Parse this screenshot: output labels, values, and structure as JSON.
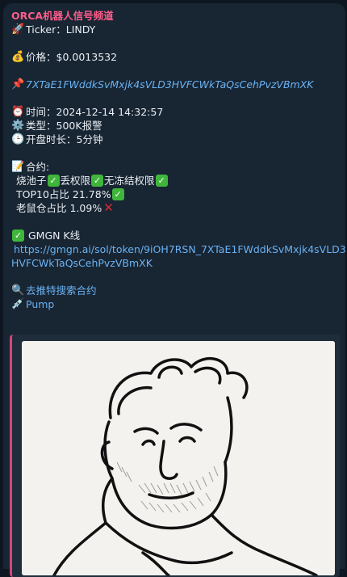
{
  "message": {
    "sender": "ORCA机器人信号频道",
    "ticker_label": "Ticker：",
    "ticker": "LINDY",
    "price_label": "价格：",
    "price": "$0.0013532",
    "contract_address": "7XTaE1FWddkSvMxjk4sVLD3HVFCWkTaQsCehPvzVBmXK",
    "time_label": "时间：",
    "time": "2024-12-14 14:32:57",
    "type_label": "类型：",
    "type": "500K报警",
    "duration_label": "开盘时长：",
    "duration": "5分钟",
    "contract_heading": "合约:",
    "contract_checks": [
      "烧池子",
      "丢权限",
      "无冻结权限"
    ],
    "top10_label": "TOP10占比",
    "top10": "21.78%",
    "rat_label": "老鼠仓占比",
    "rat": "1.09%",
    "gmgn_label": "GMGN K线",
    "gmgn_url_line1": "https://gmgn.ai/sol/token/9iOH7RSN_7XTaE1FWddkSvMxjk4sVLD3",
    "gmgn_url_line2": "HVFCWkTaQsCehPvzVBmXK",
    "search_link": "去推特搜索合约",
    "pump_link": "Pump"
  },
  "icons": {
    "rocket": "rocket-icon",
    "money_bag": "money-bag-icon",
    "pin": "pushpin-icon",
    "clock": "alarm-clock-icon",
    "gear": "gear-icon",
    "timer": "clock-icon",
    "memo": "memo-icon",
    "check": "check-mark-icon",
    "cross": "cross-mark-icon",
    "magnifier": "magnifier-icon",
    "syringe": "syringe-icon"
  },
  "colors": {
    "background": "#0e1621",
    "bubble": "#182533",
    "sender": "#ff5c8a",
    "link": "#6ab3f3",
    "preview_border": "#d8447a",
    "check": "#3fb63b",
    "cross": "#e0262b"
  }
}
